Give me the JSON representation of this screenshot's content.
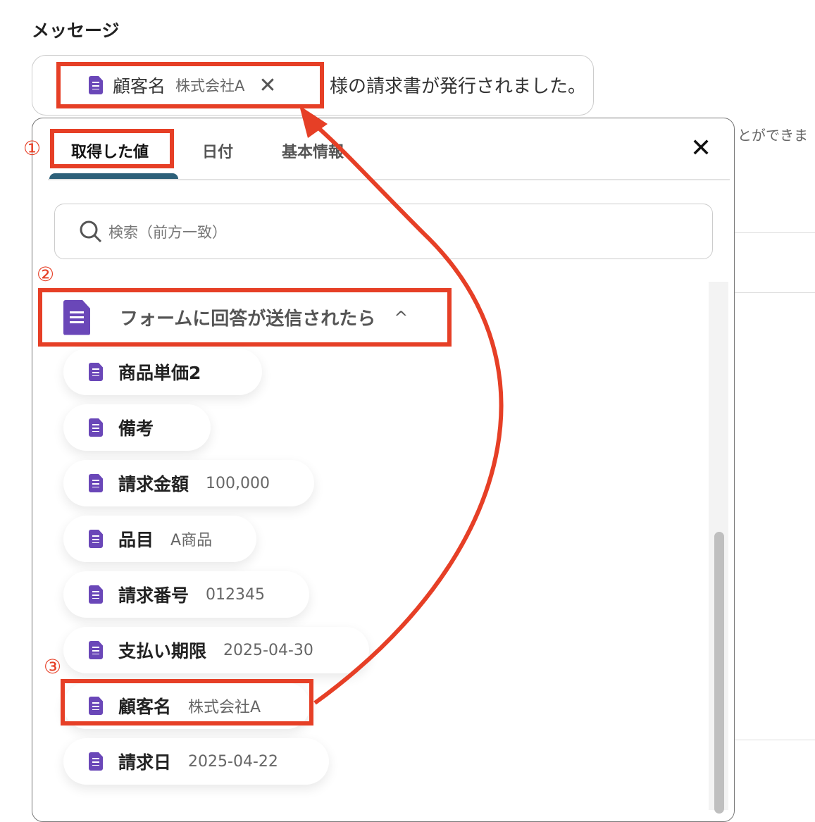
{
  "title": "メッセージ",
  "message": {
    "chip_name": "顧客名",
    "chip_value": "株式会社A",
    "chip_remove": "✕",
    "text": "様の請求書が発行されました。"
  },
  "behind_text": "とができま",
  "panel": {
    "tabs": [
      {
        "label": "取得した値"
      },
      {
        "label": "日付"
      },
      {
        "label": "基本情報"
      }
    ],
    "close": "✕",
    "search_placeholder": "検索（前方一致）",
    "group": {
      "label": "フォームに回答が送信されたら",
      "chevron": "^"
    },
    "items": [
      {
        "name": "商品単価2",
        "value": ""
      },
      {
        "name": "備考",
        "value": ""
      },
      {
        "name": "請求金額",
        "value": "100,000"
      },
      {
        "name": "品目",
        "value": "A商品"
      },
      {
        "name": "請求番号",
        "value": "012345"
      },
      {
        "name": "支払い期限",
        "value": "2025-04-30"
      },
      {
        "name": "顧客名",
        "value": "株式会社A"
      },
      {
        "name": "請求日",
        "value": "2025-04-22"
      }
    ]
  },
  "annotations": [
    "①",
    "②",
    "③"
  ],
  "colors": {
    "highlight": "#e63f26",
    "form_icon": "#6a47b8",
    "tab_underline": "#2d6079"
  }
}
